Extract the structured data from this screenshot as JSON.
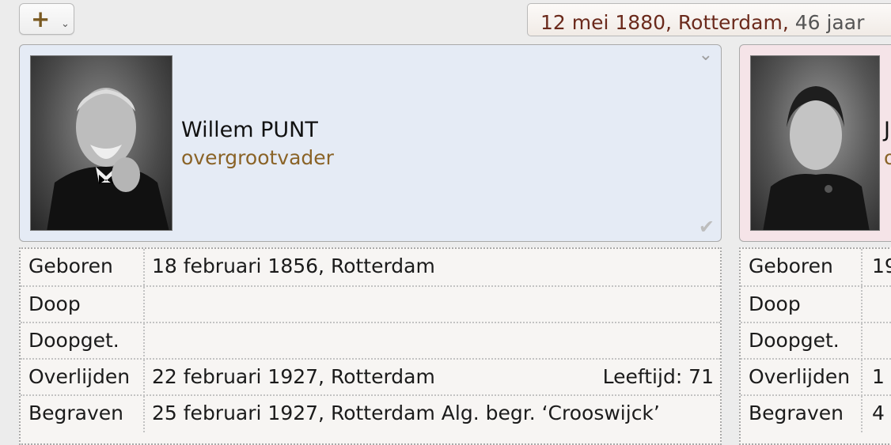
{
  "toolbar": {
    "add_icon": "plus-icon",
    "add_glyph": "+",
    "chevron_glyph": "⌄"
  },
  "marriage": {
    "date_place": "12 mei 1880, Rotterdam",
    "separator": ",",
    "age_text": "46 jaar"
  },
  "husband": {
    "name": "Willem PUNT",
    "relation": "overgrootvader",
    "facts": [
      {
        "label": "Geboren",
        "value": "18 februari 1856, Rotterdam",
        "age": ""
      },
      {
        "label": "Doop",
        "value": "",
        "age": ""
      },
      {
        "label": "Doopget.",
        "value": "",
        "age": ""
      },
      {
        "label": "Overlijden",
        "value": "22 februari 1927, Rotterdam",
        "age": "Leeftijd: 71"
      },
      {
        "label": "Begraven",
        "value": "25 februari 1927, Rotterdam Alg. begr. ‘Crooswijck’",
        "age": ""
      }
    ]
  },
  "wife": {
    "name": "J",
    "relation": "o",
    "facts": [
      {
        "label": "Geboren",
        "value": "19"
      },
      {
        "label": "Doop",
        "value": ""
      },
      {
        "label": "Doopget.",
        "value": ""
      },
      {
        "label": "Overlijden",
        "value": "1"
      },
      {
        "label": "Begraven",
        "value": "4"
      }
    ]
  },
  "colors": {
    "husband_card": "#e5ebf5",
    "wife_card": "#f5e4e8",
    "relation_text": "#8a6327",
    "marriage_date": "#6b2a1c"
  }
}
